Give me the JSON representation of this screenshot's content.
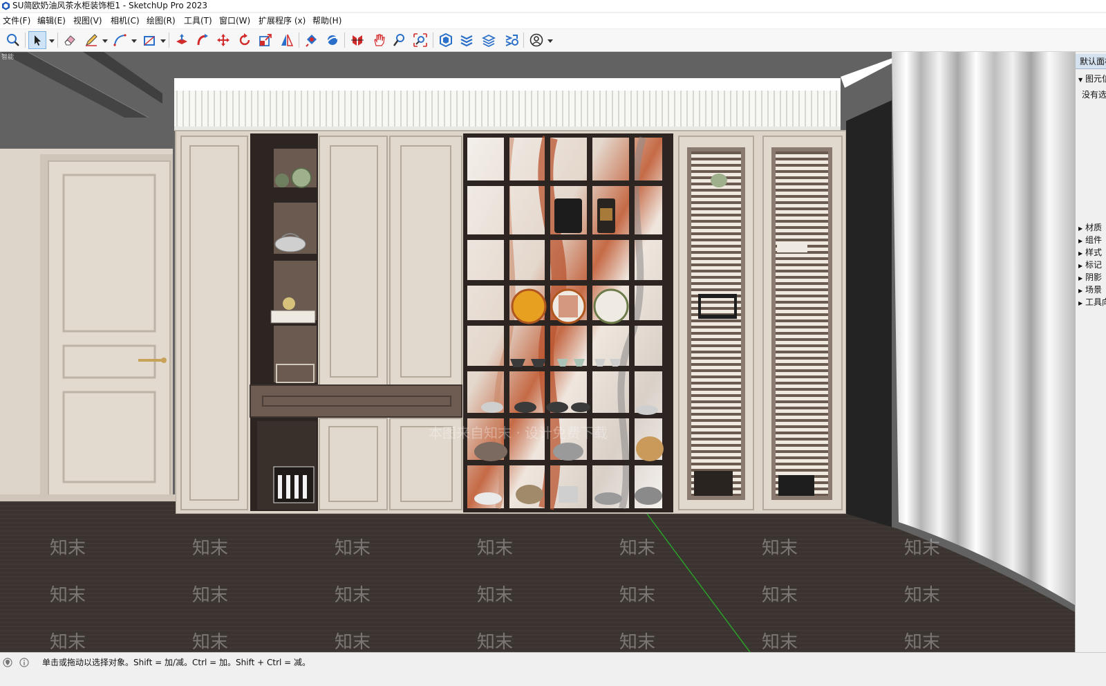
{
  "window": {
    "title": "SU简欧奶油风茶水柜装饰柜1 - SketchUp Pro 2023"
  },
  "menu": [
    {
      "label": "文件(F)"
    },
    {
      "label": "编辑(E)"
    },
    {
      "label": "视图(V)"
    },
    {
      "label": "相机(C)"
    },
    {
      "label": "绘图(R)"
    },
    {
      "label": "工具(T)"
    },
    {
      "label": "窗口(W)"
    },
    {
      "label": "扩展程序 (x)"
    },
    {
      "label": "帮助(H)"
    }
  ],
  "toolbar": {
    "tools": [
      {
        "icon": "search-icon"
      },
      {
        "icon": "select-arrow-icon",
        "active": true
      },
      {
        "icon": "eraser-icon"
      },
      {
        "icon": "pencil-icon"
      },
      {
        "icon": "arc-icon"
      },
      {
        "icon": "rectangle-icon"
      },
      {
        "icon": "push-pull-icon"
      },
      {
        "icon": "follow-me-icon"
      },
      {
        "icon": "move-icon"
      },
      {
        "icon": "rotate-icon"
      },
      {
        "icon": "scale-icon"
      },
      {
        "icon": "flip-icon"
      },
      {
        "icon": "paint-bucket-icon"
      },
      {
        "icon": "orbit-icon"
      },
      {
        "icon": "section-plane-icon"
      },
      {
        "icon": "pan-icon"
      },
      {
        "icon": "zoom-icon"
      },
      {
        "icon": "zoom-extents-icon"
      },
      {
        "icon": "warehouse-icon"
      },
      {
        "icon": "layers-icon"
      },
      {
        "icon": "extension-warehouse-icon"
      },
      {
        "icon": "layout-icon"
      },
      {
        "icon": "account-icon"
      }
    ]
  },
  "viewport": {
    "corner_label": "智能",
    "watermark_text": "知末",
    "watermark_banner": "本图来自知末 · 设计免费下载"
  },
  "tray": {
    "title": "默认面板",
    "top_section": "图元信息",
    "top_note": "没有选择内容",
    "panels": [
      {
        "label": "材质"
      },
      {
        "label": "组件"
      },
      {
        "label": "样式"
      },
      {
        "label": "标记"
      },
      {
        "label": "阴影"
      },
      {
        "label": "场景"
      },
      {
        "label": "工具向导"
      }
    ]
  },
  "status": {
    "message": "单击或拖动以选择对象。Shift = 加/减。Ctrl = 加。Shift + Ctrl = 减。"
  },
  "colors": {
    "cabinet_cream": "#ddd5c9",
    "cabinet_frame": "#2d2521",
    "floor": "#3a322e",
    "wall_gray": "#626262",
    "marble_orange": "#c0603c",
    "green_axis": "#2aa12a",
    "accent_blue": "#2a6fc9"
  }
}
